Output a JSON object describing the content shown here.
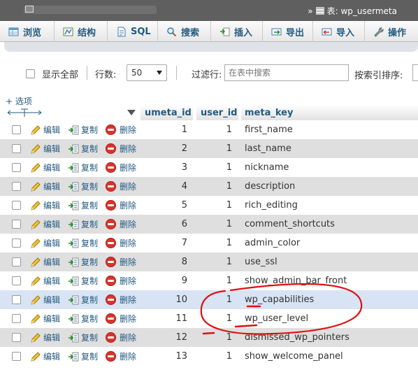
{
  "titlebar": {
    "breadcrumb_prefix": "»",
    "table_label": "表: wp_usermeta"
  },
  "tabs": [
    {
      "label": "浏览",
      "icon": "table-browse-icon"
    },
    {
      "label": "结构",
      "icon": "structure-icon"
    },
    {
      "label": "SQL",
      "icon": "sql-icon"
    },
    {
      "label": "搜索",
      "icon": "search-icon"
    },
    {
      "label": "插入",
      "icon": "insert-icon"
    },
    {
      "label": "导出",
      "icon": "export-icon"
    },
    {
      "label": "导入",
      "icon": "import-icon"
    },
    {
      "label": "操作",
      "icon": "wrench-icon"
    }
  ],
  "controls": {
    "show_all_label": "显示全部",
    "rows_label": "行数:",
    "rows_value": "50",
    "filter_label": "过滤行:",
    "filter_placeholder": "在表中搜索",
    "sort_label": "按索引排序:"
  },
  "options_label": "+ 选项",
  "table": {
    "columns": [
      "umeta_id",
      "user_id",
      "meta_key"
    ],
    "actions": {
      "edit": "编辑",
      "copy": "复制",
      "delete": "删除"
    },
    "rows": [
      {
        "umeta_id": "1",
        "user_id": "1",
        "meta_key": "first_name"
      },
      {
        "umeta_id": "2",
        "user_id": "1",
        "meta_key": "last_name"
      },
      {
        "umeta_id": "3",
        "user_id": "1",
        "meta_key": "nickname"
      },
      {
        "umeta_id": "4",
        "user_id": "1",
        "meta_key": "description"
      },
      {
        "umeta_id": "5",
        "user_id": "1",
        "meta_key": "rich_editing"
      },
      {
        "umeta_id": "6",
        "user_id": "1",
        "meta_key": "comment_shortcuts"
      },
      {
        "umeta_id": "7",
        "user_id": "1",
        "meta_key": "admin_color"
      },
      {
        "umeta_id": "8",
        "user_id": "1",
        "meta_key": "use_ssl"
      },
      {
        "umeta_id": "9",
        "user_id": "1",
        "meta_key": "show_admin_bar_front"
      },
      {
        "umeta_id": "10",
        "user_id": "1",
        "meta_key": "wp_capabilities"
      },
      {
        "umeta_id": "11",
        "user_id": "1",
        "meta_key": "wp_user_level"
      },
      {
        "umeta_id": "12",
        "user_id": "1",
        "meta_key": "dismissed_wp_pointers"
      },
      {
        "umeta_id": "13",
        "user_id": "1",
        "meta_key": "show_welcome_panel"
      }
    ],
    "highlighted_row": "10"
  },
  "colors": {
    "link": "#235a81",
    "row_even": "#dfdfdf",
    "row_highlight": "#d8e4f4",
    "annotation": "#e01010"
  }
}
